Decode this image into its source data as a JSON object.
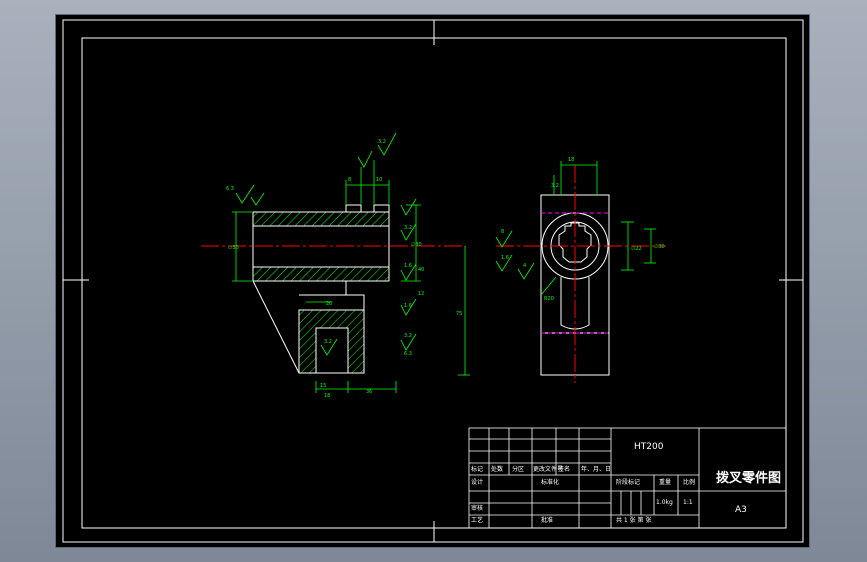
{
  "colors": {
    "background": "#000000",
    "frame": "#ffffff",
    "outline": "#ffffff",
    "dimension": "#00ff00",
    "center_line": "#ff0000",
    "hidden_line": "#ff00ff",
    "hatch": "#00ff00",
    "window_gradient_top": "#a9b1bd",
    "window_gradient_bottom": "#7f8897"
  },
  "title_block": {
    "material": "HT200",
    "part_name": "拨叉零件图",
    "drawing_size": "A3",
    "row_headers": [
      "标记",
      "处数",
      "分区",
      "更改文件号",
      "签名",
      "年、月、日"
    ],
    "design_label": "设计",
    "standard_label": "标准化",
    "stage_label": "阶段标记",
    "weight_label": "重量",
    "scale_label": "比例",
    "weight_value": "1.0kg",
    "scale_value": "1:1",
    "review_label": "审核",
    "process_label": "工艺",
    "approve_label": "批准",
    "sheets_label": "共 1 张  第   张"
  },
  "dimensions": {
    "left_view": [
      "6.3",
      "3.2",
      "10",
      "8",
      "3.2",
      "∅30",
      "∅30",
      "1.6",
      "12",
      "1.6",
      "20",
      "3.2",
      "40",
      "3.2",
      "6.3",
      "36",
      "15",
      "75",
      "18"
    ],
    "right_view": [
      "18",
      "3.2",
      "8",
      "1.6",
      "∅22",
      "4",
      "R20",
      "∅30"
    ]
  }
}
